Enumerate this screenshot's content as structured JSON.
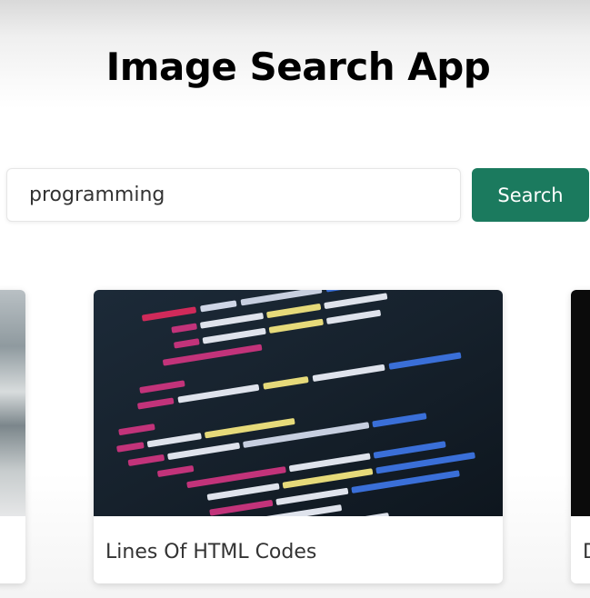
{
  "header": {
    "title": "Image Search App"
  },
  "search": {
    "value": "programming",
    "button_label": "Search"
  },
  "results": [
    {
      "caption": ""
    },
    {
      "caption": "Lines Of HTML Codes"
    },
    {
      "caption": "D"
    }
  ],
  "colors": {
    "accent": "#1b7a5e",
    "card_background": "#ffffff"
  }
}
